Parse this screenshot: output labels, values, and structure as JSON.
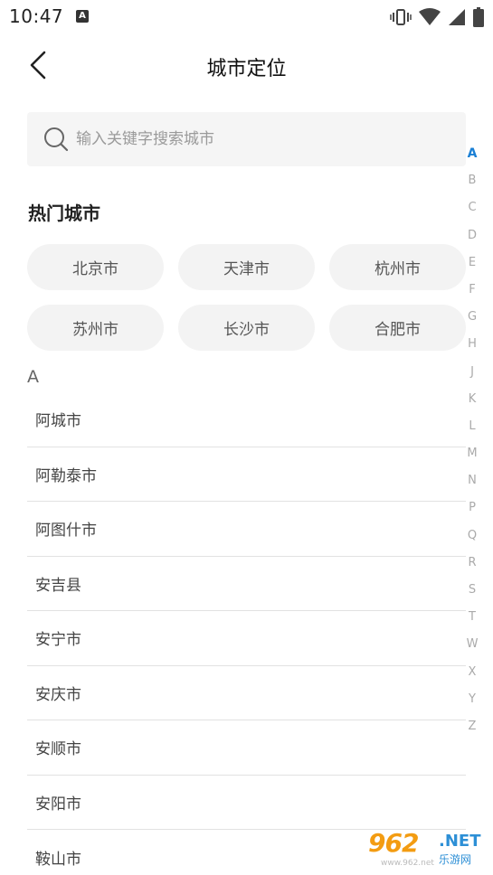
{
  "status_bar": {
    "time": "10:47",
    "notification_icon": "a-icon",
    "icons": [
      "vibrate-icon",
      "wifi-icon",
      "signal-icon",
      "battery-icon"
    ]
  },
  "nav": {
    "title": "城市定位",
    "back_icon": "chevron-left-icon"
  },
  "search": {
    "placeholder": "输入关键字搜索城市",
    "value": ""
  },
  "hot_cities": {
    "title": "热门城市",
    "items": [
      "北京市",
      "天津市",
      "杭州市",
      "苏州市",
      "长沙市",
      "合肥市"
    ]
  },
  "section": {
    "letter": "A",
    "cities": [
      "阿城市",
      "阿勒泰市",
      "阿图什市",
      "安吉县",
      "安宁市",
      "安庆市",
      "安顺市",
      "安阳市",
      "鞍山市"
    ]
  },
  "index_bar": {
    "letters": [
      "A",
      "B",
      "C",
      "D",
      "E",
      "F",
      "G",
      "H",
      "J",
      "K",
      "L",
      "M",
      "N",
      "P",
      "Q",
      "R",
      "S",
      "T",
      "W",
      "X",
      "Y",
      "Z"
    ],
    "active": "A"
  },
  "colors": {
    "accent": "#1a7fd4",
    "chip_bg": "#f3f3f3",
    "search_bg": "#f5f5f5"
  },
  "watermark": {
    "number": "962",
    "net": ".NET",
    "sub": "乐游网",
    "url": "www.962.net"
  }
}
